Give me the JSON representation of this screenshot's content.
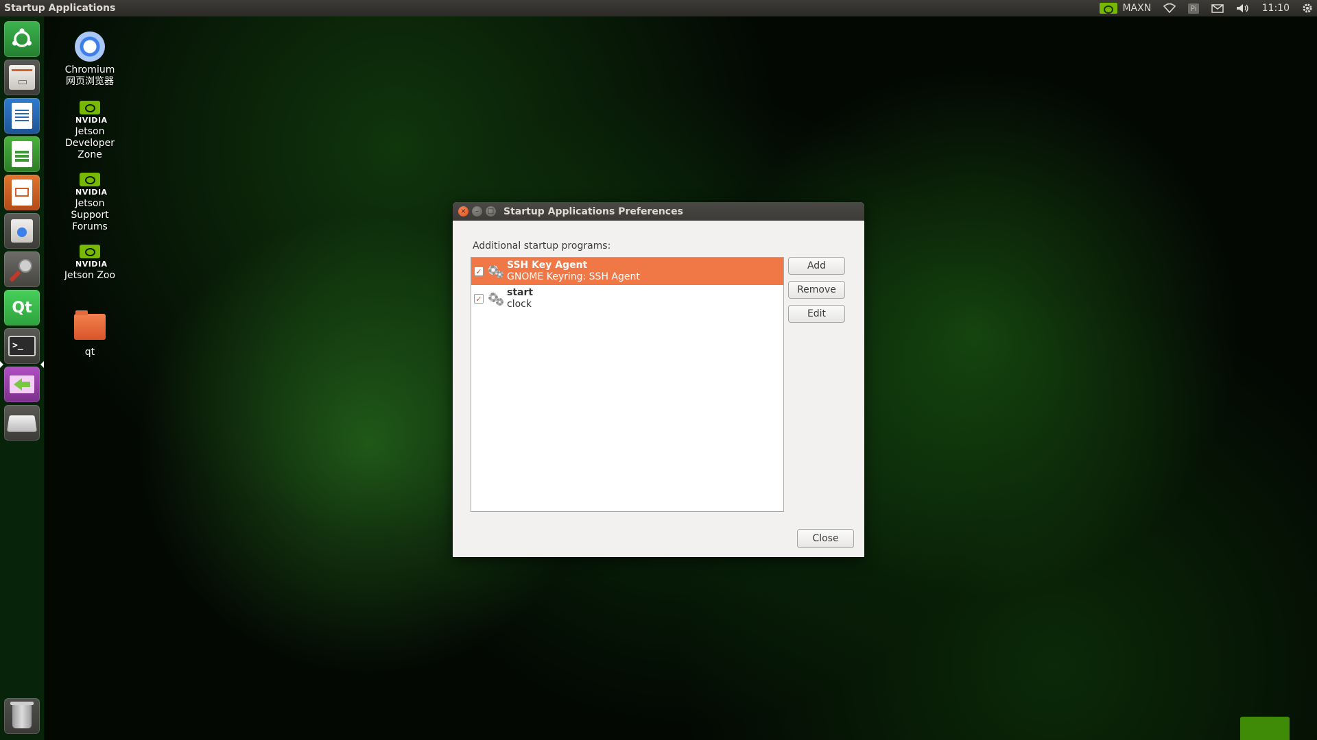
{
  "top_panel": {
    "app_title": "Startup Applications",
    "indicators": {
      "power_mode": "MAXN",
      "pi_label": "Pi",
      "clock": "11:10"
    },
    "icons": [
      "nvidia-icon",
      "wifi-icon",
      "mail-icon",
      "volume-icon",
      "settings-gear-icon"
    ]
  },
  "launcher": {
    "items": [
      {
        "name": "ubuntu-dash",
        "icon": "ubuntu-logo-icon",
        "color": "#2f9a3f"
      },
      {
        "name": "files",
        "icon": "file-cabinet-icon",
        "color": "#e6e3df"
      },
      {
        "name": "libreoffice-writer",
        "icon": "writer-icon",
        "color": "#2b6db4"
      },
      {
        "name": "libreoffice-calc",
        "icon": "calc-icon",
        "color": "#3c9a32"
      },
      {
        "name": "libreoffice-impress",
        "icon": "impress-icon",
        "color": "#d35f22"
      },
      {
        "name": "software-center",
        "icon": "shopping-bag-icon",
        "color": "#d9d6d2"
      },
      {
        "name": "system-settings",
        "icon": "tools-icon",
        "color": "#6d6d6d"
      },
      {
        "name": "qt-creator",
        "icon": "qt-icon",
        "color": "#41cd52"
      },
      {
        "name": "terminal",
        "icon": "terminal-icon",
        "color": "#2b2b2b"
      },
      {
        "name": "startup-applications",
        "icon": "startup-arrow-icon",
        "color": "#7b3d8a"
      },
      {
        "name": "removable-drive",
        "icon": "drive-icon",
        "color": "#cfcfcf"
      },
      {
        "name": "trash",
        "icon": "trash-icon",
        "color": "#4a4a4a"
      }
    ],
    "qt_label": "Qt",
    "terminal_label": ">_"
  },
  "desktop": {
    "icons": [
      {
        "label": "Chromium\n网页浏览器",
        "icon": "chromium-icon"
      },
      {
        "label": "Jetson\nDeveloper\nZone",
        "icon": "nvidia-icon"
      },
      {
        "label": "Jetson\nSupport\nForums",
        "icon": "nvidia-icon"
      },
      {
        "label": "Jetson Zoo",
        "icon": "nvidia-icon"
      },
      {
        "label": "qt",
        "icon": "folder-icon"
      }
    ],
    "nvidia_word": "NVIDIA"
  },
  "dialog": {
    "title": "Startup Applications Preferences",
    "section_label": "Additional startup programs:",
    "programs": [
      {
        "name": "SSH Key Agent",
        "description": "GNOME Keyring: SSH Agent",
        "enabled": true,
        "selected": true
      },
      {
        "name": "start",
        "description": "clock",
        "enabled": true,
        "selected": false
      }
    ],
    "buttons": {
      "add": "Add",
      "remove": "Remove",
      "edit": "Edit",
      "close": "Close"
    },
    "accent_color": "#f07746"
  }
}
